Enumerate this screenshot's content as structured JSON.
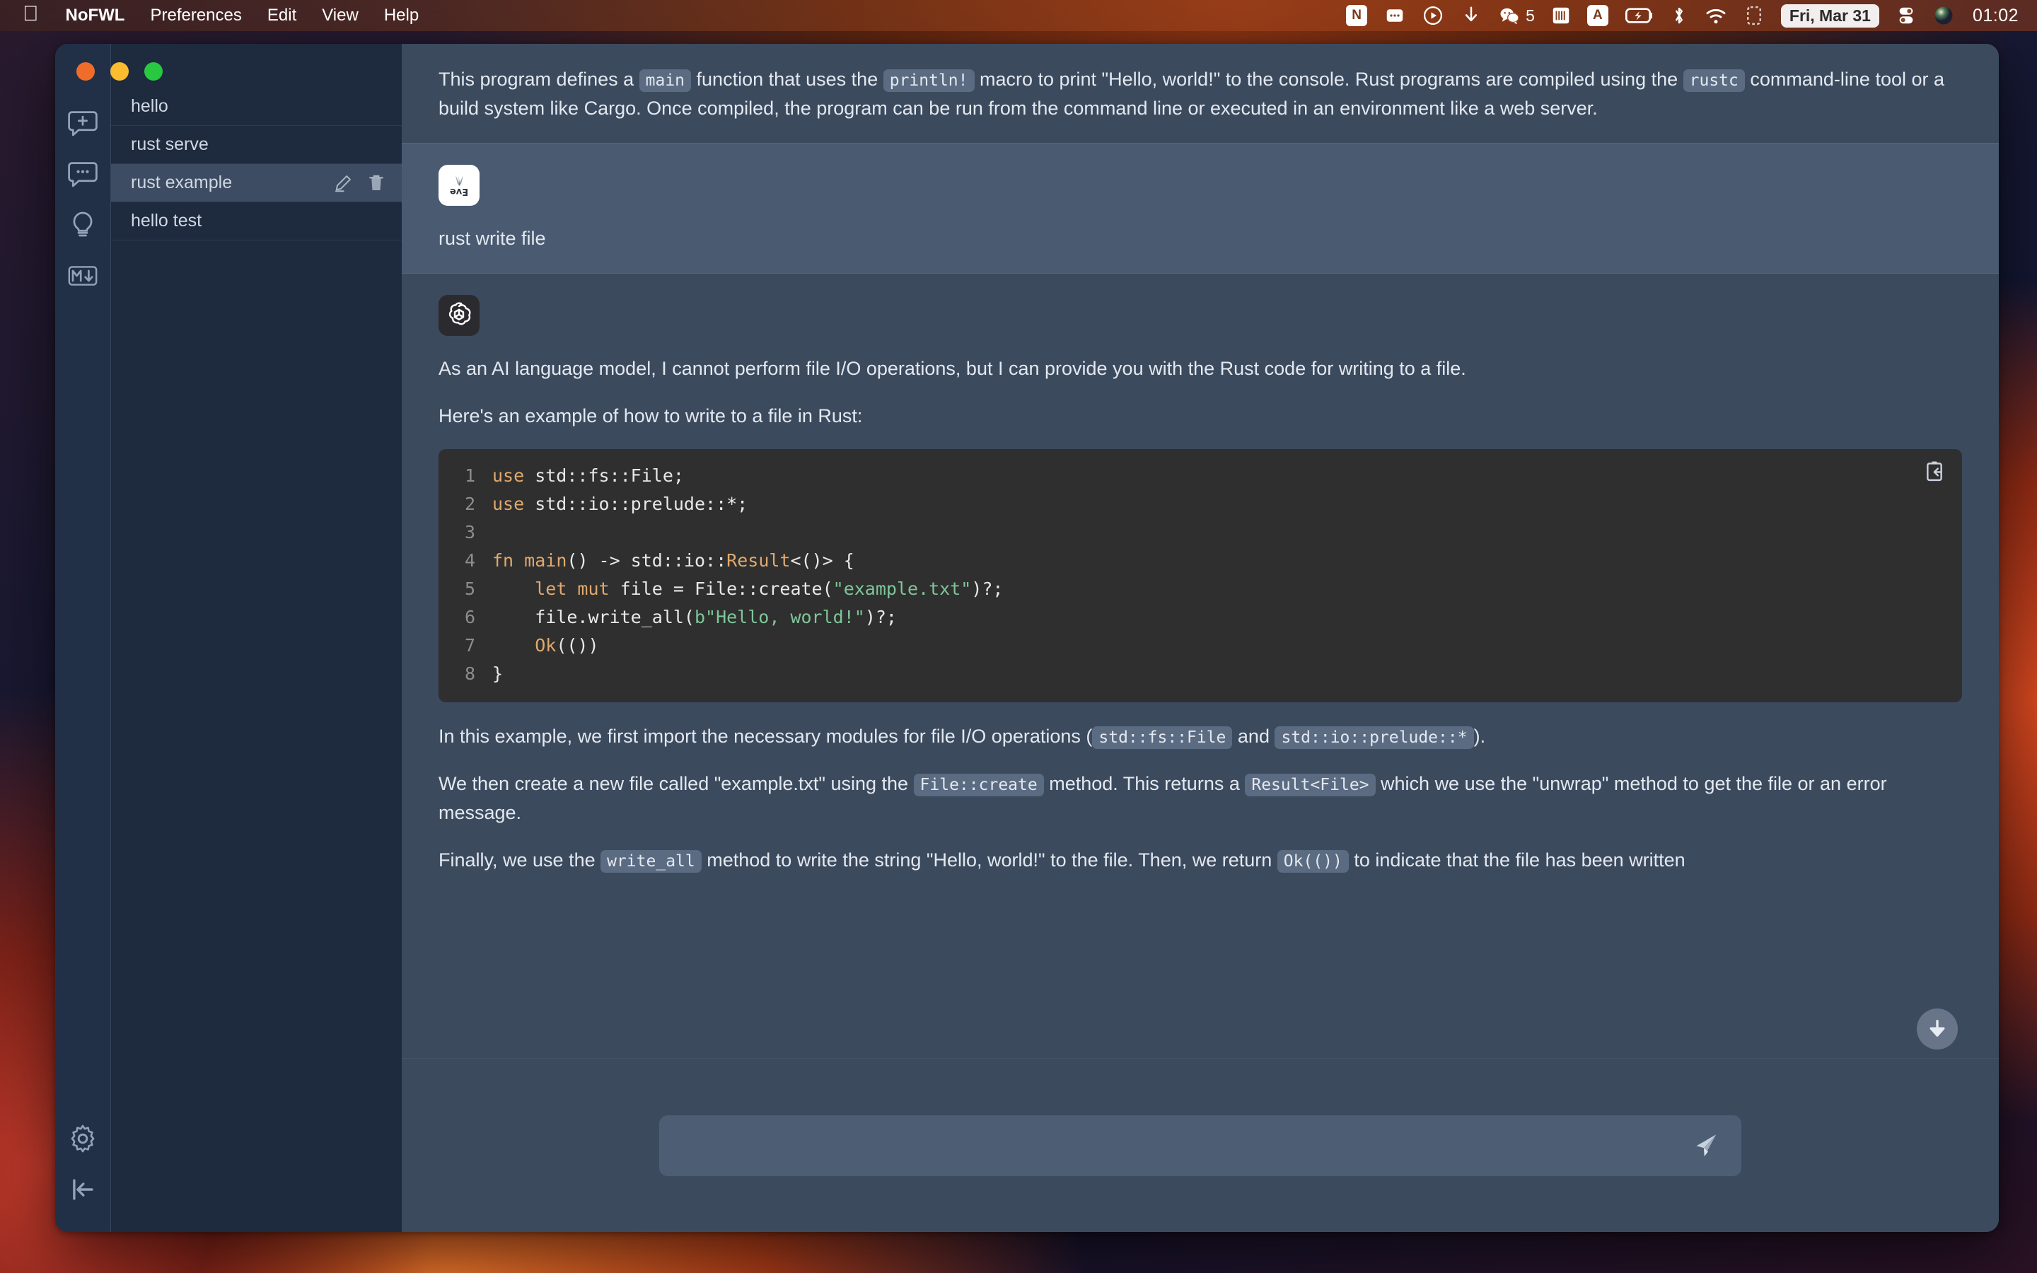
{
  "menubar": {
    "apple_icon": "apple-logo",
    "items": [
      {
        "label": "NoFWL",
        "bold": true
      },
      {
        "label": "Preferences",
        "bold": false
      },
      {
        "label": "Edit",
        "bold": false
      },
      {
        "label": "View",
        "bold": false
      },
      {
        "label": "Help",
        "bold": false
      }
    ],
    "tray": {
      "notion_label": "N",
      "input_source_label": "A",
      "wechat_badge": "5",
      "date": "Fri, Mar 31",
      "time": "01:02"
    }
  },
  "window": {
    "traffic_lights": [
      "close",
      "minimize",
      "zoom"
    ],
    "rail": {
      "icons": [
        {
          "name": "new-chat-icon"
        },
        {
          "name": "chat-bubble-icon"
        },
        {
          "name": "lightbulb-icon"
        },
        {
          "name": "markdown-icon",
          "label": "M↓"
        }
      ],
      "bottom_icons": [
        {
          "name": "settings-gear-icon"
        },
        {
          "name": "collapse-sidebar-icon"
        }
      ]
    },
    "chat_list": [
      {
        "title": "hello",
        "selected": false
      },
      {
        "title": "rust serve",
        "selected": false
      },
      {
        "title": "rust example",
        "selected": true
      },
      {
        "title": "hello test",
        "selected": false
      }
    ]
  },
  "conversation": {
    "top_message": {
      "parts": [
        {
          "type": "text",
          "value": "This program defines a "
        },
        {
          "type": "code",
          "value": "main"
        },
        {
          "type": "text",
          "value": " function that uses the "
        },
        {
          "type": "code",
          "value": "println!"
        },
        {
          "type": "text",
          "value": " macro to print \"Hello, world!\" to the console. Rust programs are compiled using the "
        },
        {
          "type": "code",
          "value": "rustc"
        },
        {
          "type": "text",
          "value": " command-line tool or a build system like Cargo. Once compiled, the program can be run from the command line or executed in an environment like a web server."
        }
      ]
    },
    "user_message": {
      "avatar": "user-avatar",
      "text": "rust write file"
    },
    "assistant_message": {
      "avatar": "openai-logo",
      "paragraph_1": "As an AI language model, I cannot perform file I/O operations, but I can provide you with the Rust code for writing to a file.",
      "paragraph_2": "Here's an example of how to write to a file in Rust:",
      "code_block": {
        "language": "rust",
        "copy_icon": "copy-to-clipboard-icon",
        "lines": [
          {
            "n": "1",
            "tokens": [
              {
                "t": "kw",
                "v": "use"
              },
              {
                "t": "txt",
                "v": " std::fs::File;"
              }
            ]
          },
          {
            "n": "2",
            "tokens": [
              {
                "t": "kw",
                "v": "use"
              },
              {
                "t": "txt",
                "v": " std::io::prelude::*;"
              }
            ]
          },
          {
            "n": "3",
            "tokens": [
              {
                "t": "txt",
                "v": ""
              }
            ]
          },
          {
            "n": "4",
            "tokens": [
              {
                "t": "kw",
                "v": "fn"
              },
              {
                "t": "txt",
                "v": " "
              },
              {
                "t": "fnm",
                "v": "main"
              },
              {
                "t": "txt",
                "v": "() -> std::io::"
              },
              {
                "t": "typ",
                "v": "Result"
              },
              {
                "t": "txt",
                "v": "<()> {"
              }
            ]
          },
          {
            "n": "5",
            "tokens": [
              {
                "t": "txt",
                "v": "    "
              },
              {
                "t": "kw",
                "v": "let mut"
              },
              {
                "t": "txt",
                "v": " file = File::create("
              },
              {
                "t": "str",
                "v": "\"example.txt\""
              },
              {
                "t": "txt",
                "v": ")?;"
              }
            ]
          },
          {
            "n": "6",
            "tokens": [
              {
                "t": "txt",
                "v": "    file.write_all("
              },
              {
                "t": "str",
                "v": "b\"Hello, world!\""
              },
              {
                "t": "txt",
                "v": ")?;"
              }
            ]
          },
          {
            "n": "7",
            "tokens": [
              {
                "t": "txt",
                "v": "    "
              },
              {
                "t": "typ",
                "v": "Ok"
              },
              {
                "t": "txt",
                "v": "(())"
              }
            ]
          },
          {
            "n": "8",
            "tokens": [
              {
                "t": "txt",
                "v": "}"
              }
            ]
          }
        ]
      },
      "paragraph_3": [
        {
          "type": "text",
          "value": "In this example, we first import the necessary modules for file I/O operations ("
        },
        {
          "type": "code",
          "value": "std::fs::File"
        },
        {
          "type": "text",
          "value": " and "
        },
        {
          "type": "code",
          "value": "std::io::prelude::*"
        },
        {
          "type": "text",
          "value": ")."
        }
      ],
      "paragraph_4": [
        {
          "type": "text",
          "value": "We then create a new file called \"example.txt\" using the "
        },
        {
          "type": "code",
          "value": "File::create"
        },
        {
          "type": "text",
          "value": " method. This returns a "
        },
        {
          "type": "code",
          "value": "Result<File>"
        },
        {
          "type": "text",
          "value": " which we use the \"unwrap\" method to get the file or an error message."
        }
      ],
      "paragraph_5": [
        {
          "type": "text",
          "value": "Finally, we use the "
        },
        {
          "type": "code",
          "value": "write_all"
        },
        {
          "type": "text",
          "value": " method to write the string \"Hello, world!\" to the file. Then, we return "
        },
        {
          "type": "code",
          "value": "Ok(())"
        },
        {
          "type": "text",
          "value": " to indicate that the file has been written"
        }
      ]
    }
  },
  "composer": {
    "value": "",
    "placeholder": "",
    "send_icon": "send-paper-plane-icon"
  },
  "controls": {
    "scroll_to_bottom_icon": "arrow-down-circle-icon"
  },
  "colors": {
    "window_bg": "#3c4a5e",
    "sidebar_bg": "#1e2a3d",
    "rail_bg": "#223047",
    "selected_row": "#3d4c62",
    "user_msg_bg": "#4a5a70",
    "code_bg": "#2f2f2f",
    "code_keyword": "#e0a96d",
    "code_string": "#7ec699",
    "text": "#e3e8ef"
  }
}
